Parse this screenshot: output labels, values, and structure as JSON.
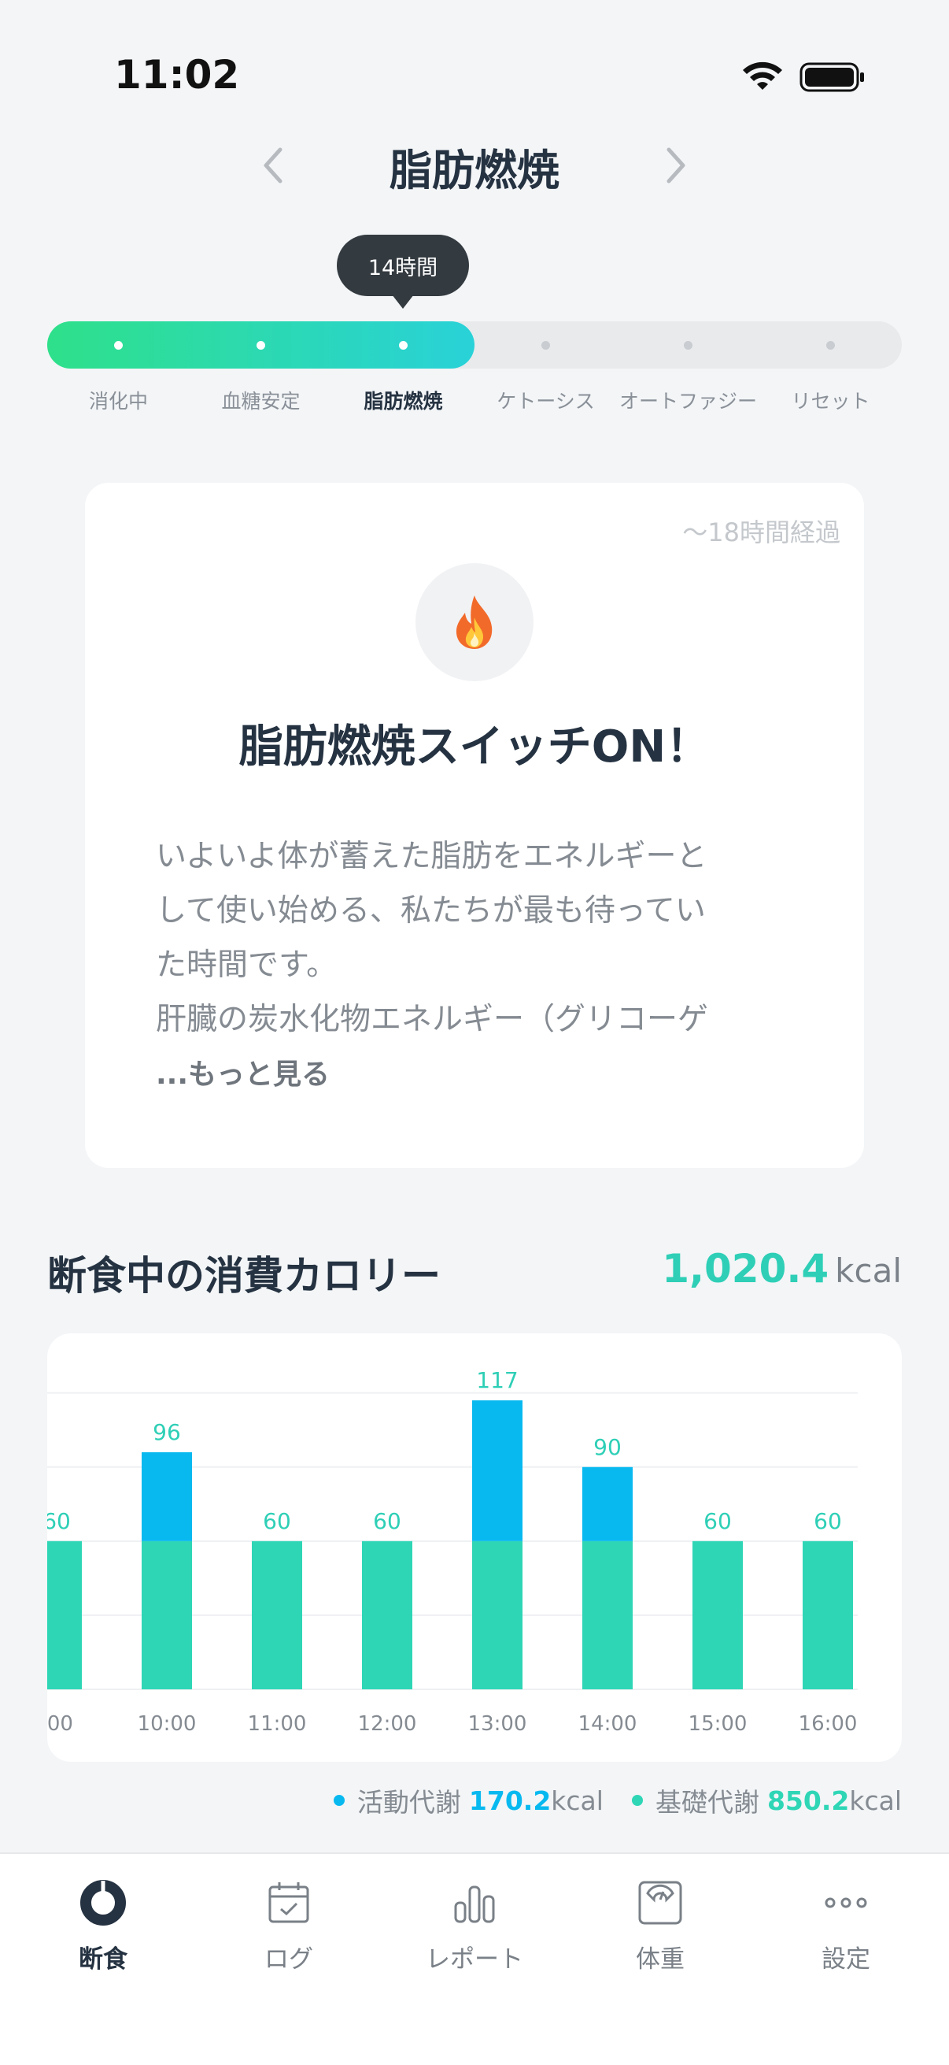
{
  "status_bar": {
    "time": "11:02"
  },
  "header": {
    "title": "脂肪燃焼"
  },
  "progress": {
    "tooltip": "14時間",
    "fill_fraction": 0.5,
    "active_index": 2,
    "stages": [
      "消化中",
      "血糖安定",
      "脂肪燃焼",
      "ケトーシス",
      "オートファジー",
      "リセット"
    ]
  },
  "card": {
    "elapsed": "〜18時間経過",
    "icon": "fire-icon",
    "heading": "脂肪燃焼スイッチON！",
    "body_lines": [
      "いよいよ体が蓄えた脂肪をエネルギーと",
      "して使い始める、私たちが最も待ってい",
      "た時間です。",
      "肝臓の炭水化物エネルギー（グリコーゲ"
    ],
    "more": "...もっと見る"
  },
  "calories": {
    "title": "断食中の消費カロリー",
    "total": "1,020.4",
    "unit": "kcal"
  },
  "chart_data": {
    "type": "bar",
    "stacked": true,
    "categories": [
      ":00",
      "10:00",
      "11:00",
      "12:00",
      "13:00",
      "14:00",
      "15:00",
      "16:00"
    ],
    "series": [
      {
        "name": "基礎代謝",
        "color": "#2ed6b6",
        "values": [
          60,
          60,
          60,
          60,
          60,
          60,
          60,
          60
        ]
      },
      {
        "name": "活動代謝",
        "color": "#08b9f0",
        "values": [
          0,
          36,
          0,
          0,
          57,
          30,
          0,
          0
        ]
      }
    ],
    "totals": [
      "60",
      "96",
      "60",
      "60",
      "117",
      "90",
      "60",
      "60"
    ],
    "ylim": [
      0,
      125
    ],
    "grid": true,
    "legend": "bottom-right"
  },
  "legend": {
    "active_label": "活動代謝",
    "active_value": "170.2",
    "active_unit": "kcal",
    "active_color": "#08b9f0",
    "basal_label": "基礎代謝",
    "basal_value": "850.2",
    "basal_unit": "kcal",
    "basal_color": "#2ed6b6"
  },
  "tabs": [
    {
      "label": "断食",
      "icon": "fasting-ring-icon",
      "active": true
    },
    {
      "label": "ログ",
      "icon": "calendar-check-icon",
      "active": false
    },
    {
      "label": "レポート",
      "icon": "bar-chart-icon",
      "active": false
    },
    {
      "label": "体重",
      "icon": "scale-icon",
      "active": false
    },
    {
      "label": "設定",
      "icon": "more-dots-icon",
      "active": false
    }
  ]
}
